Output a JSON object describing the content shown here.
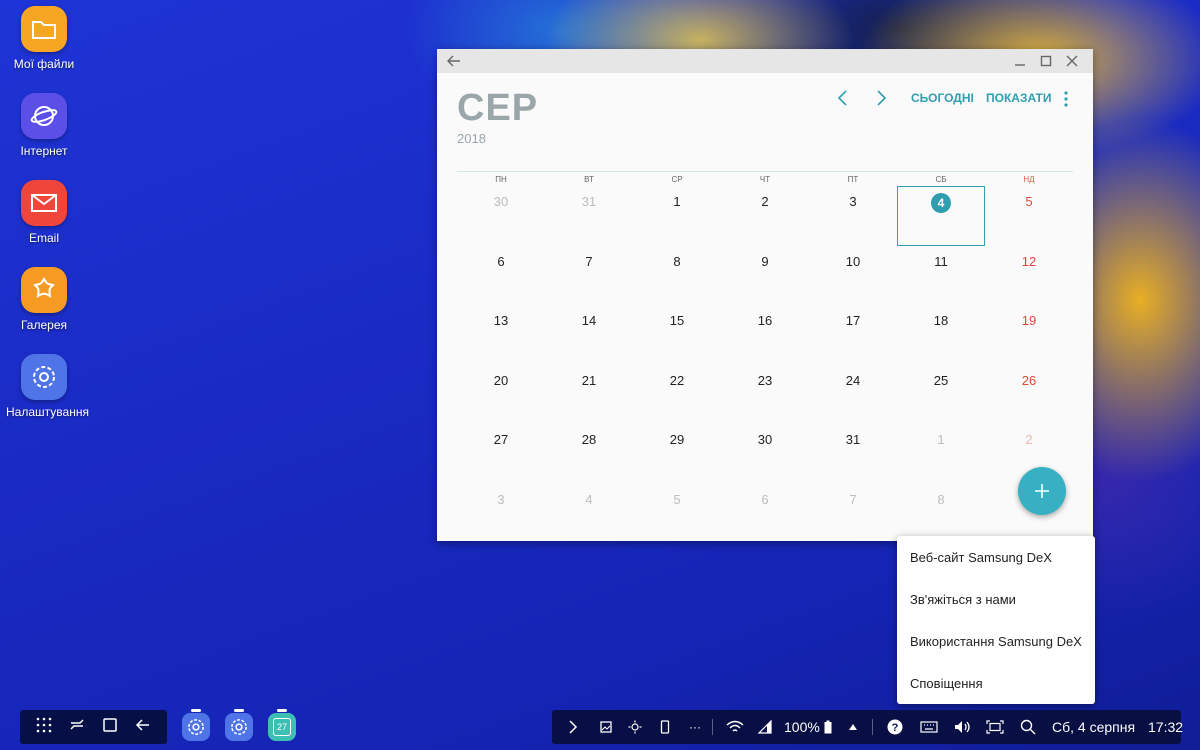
{
  "desktop": {
    "icons": [
      {
        "label": "Мої файли",
        "icon": "folder-icon",
        "color": "#f6a623"
      },
      {
        "label": "Інтернет",
        "icon": "internet-icon",
        "color": "#5b4fe8"
      },
      {
        "label": "Email",
        "icon": "email-icon",
        "color": "#f0453a"
      },
      {
        "label": "Галерея",
        "icon": "gallery-icon",
        "color": "#f59a23"
      },
      {
        "label": "Налаштування",
        "icon": "settings-icon",
        "color": "#4f74e8"
      }
    ]
  },
  "calendar": {
    "month": "СЕР",
    "year": "2018",
    "today_label": "СЬОГОДНІ",
    "show_label": "ПОКАЗАТИ",
    "weekdays": [
      "ПН",
      "ВТ",
      "СР",
      "ЧТ",
      "ПТ",
      "СБ",
      "НД"
    ],
    "weeks": [
      [
        "30",
        "31",
        "1",
        "2",
        "3",
        "4",
        "5"
      ],
      [
        "6",
        "7",
        "8",
        "9",
        "10",
        "11",
        "12"
      ],
      [
        "13",
        "14",
        "15",
        "16",
        "17",
        "18",
        "19"
      ],
      [
        "20",
        "21",
        "22",
        "23",
        "24",
        "25",
        "26"
      ],
      [
        "27",
        "28",
        "29",
        "30",
        "31",
        "1",
        "2"
      ],
      [
        "3",
        "4",
        "5",
        "6",
        "7",
        "8",
        ""
      ]
    ],
    "selected_day": "4",
    "accent": "#2f9fb0",
    "sunday_color": "#e0453a"
  },
  "menu": {
    "items": [
      "Веб-сайт Samsung DeX",
      "Зв'яжіться з нами",
      "Використання Samsung DeX",
      "Сповіщення"
    ]
  },
  "taskbar": {
    "battery": "100%",
    "datetime": "Сб, 4 серпня",
    "time": "17:32",
    "calendar_pin_day": "27"
  }
}
